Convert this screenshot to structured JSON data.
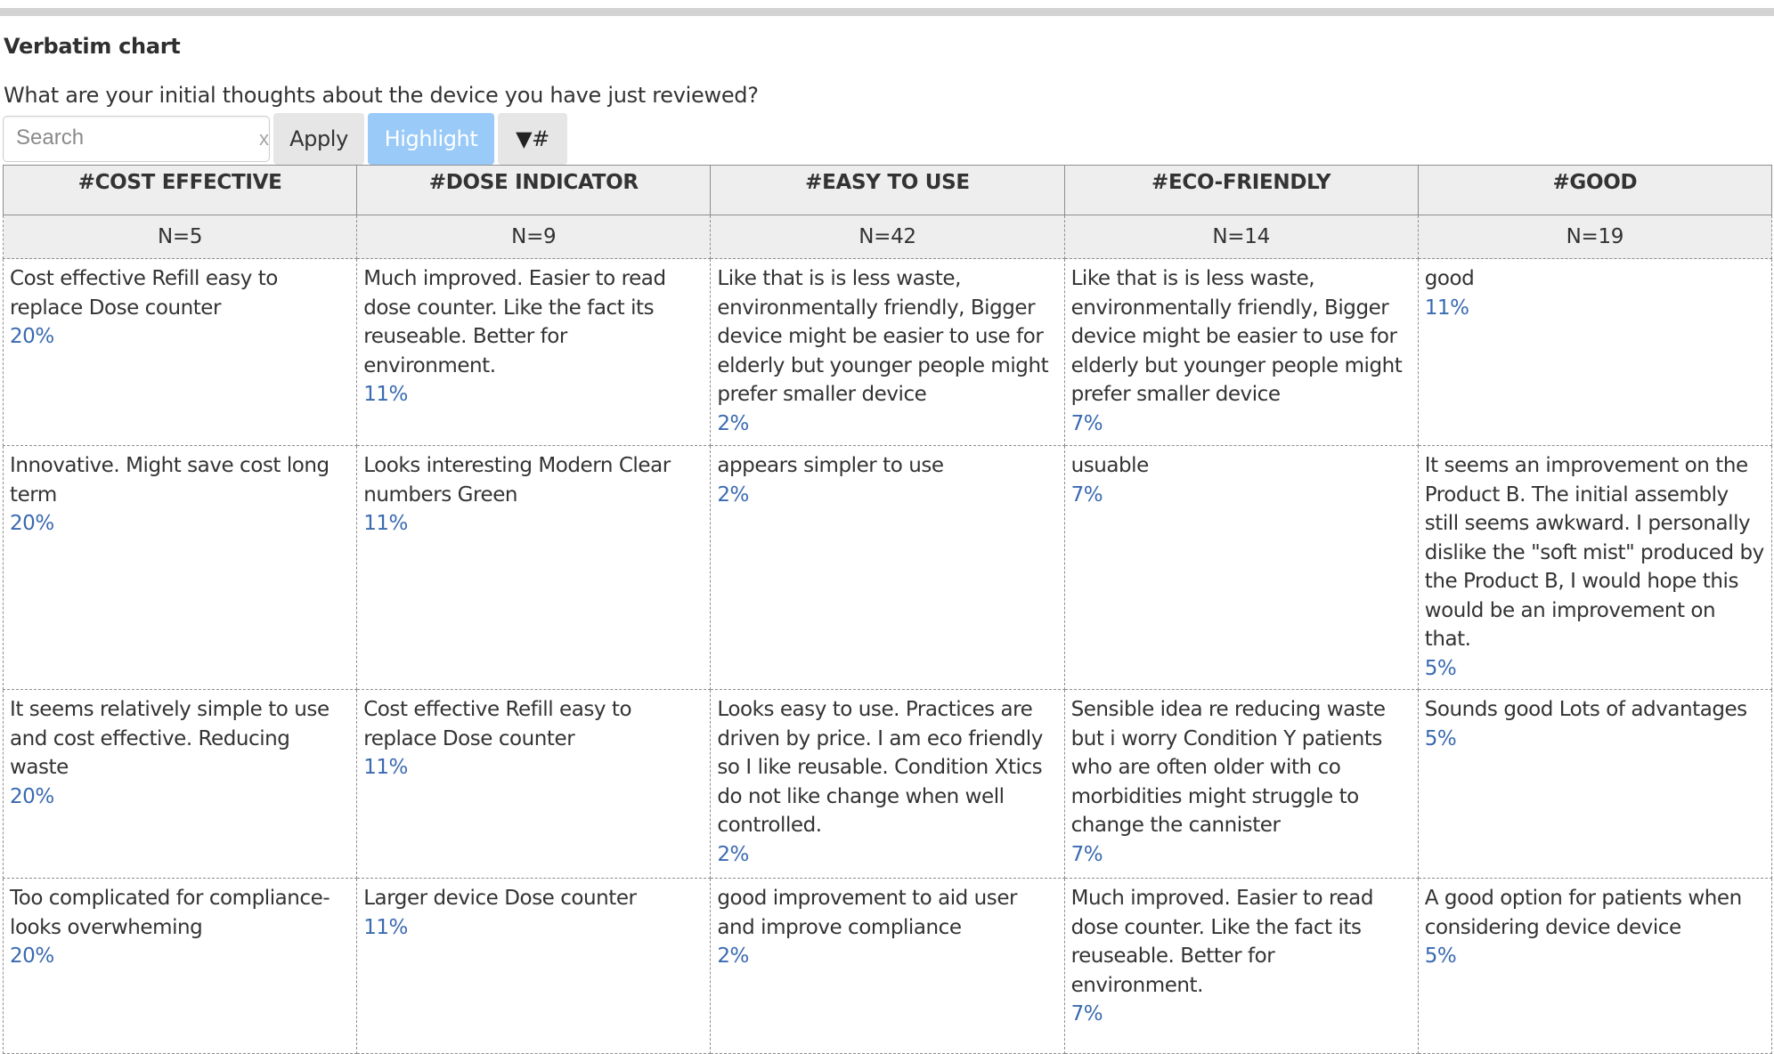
{
  "title": "Verbatim chart",
  "question": "What are your initial thoughts about the device you have just reviewed?",
  "toolbar": {
    "search_placeholder": "Search",
    "search_value": "",
    "clear_label": "x",
    "apply_label": "Apply",
    "highlight_label": "Highlight",
    "sort_label": "▼#"
  },
  "colors": {
    "highlight_button": "#99caf8",
    "percent_text": "#3a6ab0",
    "header_bg": "#eeeeee"
  },
  "chart_data": {
    "type": "table",
    "title": "Verbatim chart",
    "columns": [
      {
        "tag": "#COST EFFECTIVE",
        "n": "N=5"
      },
      {
        "tag": "#DOSE INDICATOR",
        "n": "N=9"
      },
      {
        "tag": "#EASY TO USE",
        "n": "N=42"
      },
      {
        "tag": "#ECO-FRIENDLY",
        "n": "N=14"
      },
      {
        "tag": "#GOOD",
        "n": "N=19"
      }
    ],
    "rows": [
      [
        {
          "text": "Cost effective Refill easy to replace Dose counter",
          "pct": "20%"
        },
        {
          "text": "Much improved. Easier to read dose counter. Like the fact its reuseable. Better for environment.",
          "pct": "11%"
        },
        {
          "text": "Like that is is less waste, environmentally friendly, Bigger device might be easier to use for elderly but younger people might prefer smaller device",
          "pct": "2%"
        },
        {
          "text": "Like that is is less waste, environmentally friendly, Bigger device might be easier to use for elderly but younger people might prefer smaller device",
          "pct": "7%"
        },
        {
          "text": "good",
          "pct": "11%"
        }
      ],
      [
        {
          "text": "Innovative. Might save cost long term",
          "pct": "20%"
        },
        {
          "text": "Looks interesting Modern Clear numbers Green",
          "pct": "11%"
        },
        {
          "text": "appears simpler to use",
          "pct": "2%"
        },
        {
          "text": "usuable",
          "pct": "7%"
        },
        {
          "text": "It seems an improvement on the Product B. The initial assembly still seems awkward. I personally dislike the \"soft mist\" produced by the Product B, I would hope this would be an improvement on that.",
          "pct": "5%"
        }
      ],
      [
        {
          "text": "It seems relatively simple to use and cost effective. Reducing waste",
          "pct": "20%"
        },
        {
          "text": "Cost effective Refill easy to replace Dose counter",
          "pct": "11%"
        },
        {
          "text": "Looks easy to use. Practices are driven by price. I am eco friendly so I like reusable. Condition Xtics do not like change when well controlled.",
          "pct": "2%"
        },
        {
          "text": "Sensible idea re reducing waste but i worry Condition Y patients who are often older with co morbidities might struggle to change the cannister",
          "pct": "7%"
        },
        {
          "text": "Sounds good Lots of advantages",
          "pct": "5%"
        }
      ],
      [
        {
          "text": "Too complicated for compliance-looks overwheming",
          "pct": "20%"
        },
        {
          "text": "Larger device Dose counter",
          "pct": "11%"
        },
        {
          "text": "good improvement to aid user and improve compliance",
          "pct": "2%"
        },
        {
          "text": "Much improved. Easier to read dose counter. Like the fact its reuseable. Better for environment.",
          "pct": "7%"
        },
        {
          "text": "A good option for patients when considering device device",
          "pct": "5%"
        }
      ]
    ]
  }
}
